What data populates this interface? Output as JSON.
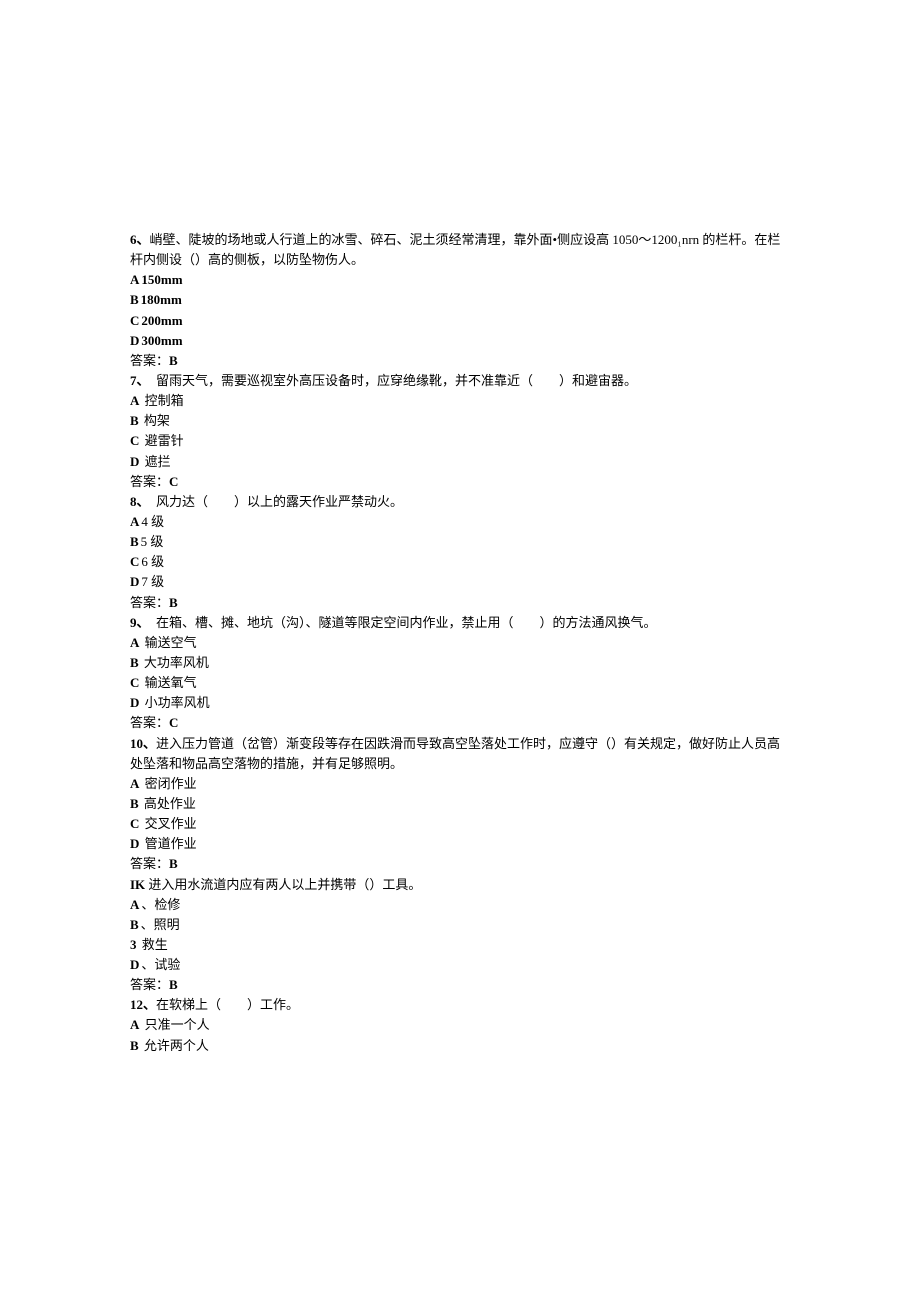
{
  "questions": [
    {
      "num": "6、",
      "stem": "峭壁、陡坡的场地或人行道上的冰雪、碎石、泥土须经常清理，靠外面•侧应设高 1050～1200₁nrn 的栏杆。在栏杆内侧设（）高的侧板，以防坠物伤人。",
      "opts": [
        {
          "label": "A",
          "text": "150mm",
          "bold": true
        },
        {
          "label": "B",
          "text": "180mm",
          "bold": true
        },
        {
          "label": "C",
          "text": "200mm",
          "bold": true
        },
        {
          "label": "D",
          "text": "300mm",
          "bold": true
        }
      ],
      "ans_label": "答案：",
      "ans_value": "B"
    },
    {
      "num": "7、",
      "stem": "　留雨天气，需要巡视室外高压设备时，应穿绝缘靴，并不准靠近（　　）和避宙器。",
      "opts": [
        {
          "label": "A",
          "text": " 控制箱",
          "bold": false
        },
        {
          "label": "B",
          "text": " 构架",
          "bold": false
        },
        {
          "label": "C",
          "text": " 避雷针",
          "bold": false
        },
        {
          "label": "D",
          "text": " 遮拦",
          "bold": false
        }
      ],
      "ans_label": "答案：",
      "ans_value": "C"
    },
    {
      "num": "8、",
      "stem": "　风力达（　　）以上的露天作业严禁动火。",
      "opts": [
        {
          "label": "A",
          "text": "4 级",
          "bold": false,
          "boldlabel": true
        },
        {
          "label": "B",
          "text": "5 级",
          "bold": false,
          "boldlabel": true
        },
        {
          "label": "C",
          "text": "6 级",
          "bold": false,
          "boldlabel": true
        },
        {
          "label": "D",
          "text": "7 级",
          "bold": false,
          "boldlabel": true
        }
      ],
      "ans_label": "答案：",
      "ans_value": "B"
    },
    {
      "num": "9、",
      "stem": "　在箱、槽、摊、地坑（沟）、隧道等限定空间内作业，禁止用（　　）的方法通风换气。",
      "opts": [
        {
          "label": "A",
          "text": " 输送空气",
          "bold": false
        },
        {
          "label": "B",
          "text": " 大功率风机",
          "bold": false
        },
        {
          "label": "C",
          "text": " 输送氧气",
          "bold": false
        },
        {
          "label": "D",
          "text": " 小功率风机",
          "bold": false
        }
      ],
      "ans_label": "答案：",
      "ans_value": "C"
    },
    {
      "num": "10、",
      "stem": "进入压力管道（岔管）渐变段等存在因跌滑而导致高空坠落处工作时，应遵守（）有关规定，做好防止人员高处坠落和物品高空落物的措施，并有足够照明。",
      "opts": [
        {
          "label": "A",
          "text": " 密闭作业",
          "bold": false
        },
        {
          "label": "B",
          "text": " 高处作业",
          "bold": false
        },
        {
          "label": "C",
          "text": " 交叉作业",
          "bold": false
        },
        {
          "label": "D",
          "text": " 管道作业",
          "bold": false
        }
      ],
      "ans_label": "答案：",
      "ans_value": "B"
    },
    {
      "num": "IK",
      "stem": " 进入用水流道内应有两人以上并携带（）工具。",
      "opts": [
        {
          "label": "A",
          "text": "、检修",
          "bold": false
        },
        {
          "label": "B",
          "text": "、照明",
          "bold": false
        },
        {
          "label": "3",
          "text": " 救生",
          "bold": false
        },
        {
          "label": "D",
          "text": "、试验",
          "bold": false
        }
      ],
      "ans_label": "答案：",
      "ans_value": "B"
    },
    {
      "num": "12、",
      "stem": "在软梯上（　　）工作。",
      "opts": [
        {
          "label": "A",
          "text": " 只准一个人",
          "bold": false
        },
        {
          "label": "B",
          "text": " 允许两个人",
          "bold": false
        }
      ],
      "ans_label": "",
      "ans_value": ""
    }
  ]
}
